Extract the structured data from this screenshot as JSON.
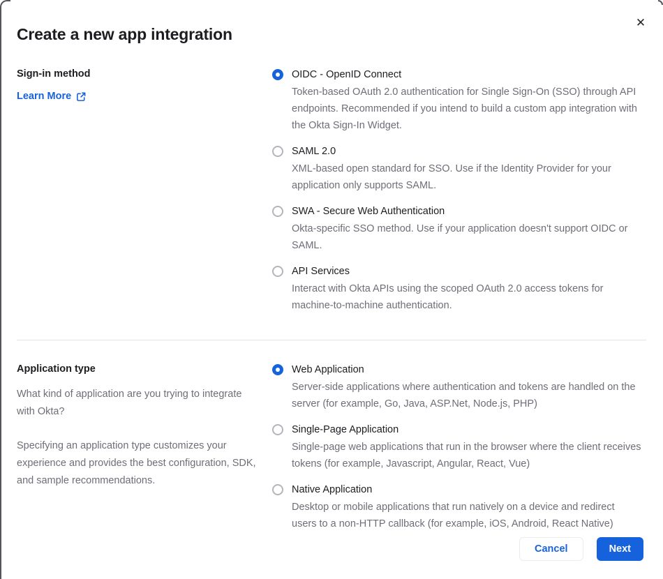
{
  "modal": {
    "title": "Create a new app integration",
    "close_icon": "✕"
  },
  "signin_section": {
    "label": "Sign-in method",
    "learn_more_label": "Learn More",
    "options": [
      {
        "label": "OIDC - OpenID Connect",
        "description": "Token-based OAuth 2.0 authentication for Single Sign-On (SSO) through API endpoints. Recommended if you intend to build a custom app integration with the Okta Sign-In Widget.",
        "selected": true
      },
      {
        "label": "SAML 2.0",
        "description": "XML-based open standard for SSO. Use if the Identity Provider for your application only supports SAML.",
        "selected": false
      },
      {
        "label": "SWA - Secure Web Authentication",
        "description": "Okta-specific SSO method. Use if your application doesn't support OIDC or SAML.",
        "selected": false
      },
      {
        "label": "API Services",
        "description": "Interact with Okta APIs using the scoped OAuth 2.0 access tokens for machine-to-machine authentication.",
        "selected": false
      }
    ]
  },
  "apptype_section": {
    "label": "Application type",
    "intro": "What kind of application are you trying to integrate with Okta?",
    "note": "Specifying an application type customizes your experience and provides the best configuration, SDK, and sample recommendations.",
    "options": [
      {
        "label": "Web Application",
        "description": "Server-side applications where authentication and tokens are handled on the server (for example, Go, Java, ASP.Net, Node.js, PHP)",
        "selected": true
      },
      {
        "label": "Single-Page Application",
        "description": "Single-page web applications that run in the browser where the client receives tokens (for example, Javascript, Angular, React, Vue)",
        "selected": false
      },
      {
        "label": "Native Application",
        "description": "Desktop or mobile applications that run natively on a device and redirect users to a non-HTTP callback (for example, iOS, Android, React Native)",
        "selected": false
      }
    ]
  },
  "footer": {
    "cancel_label": "Cancel",
    "next_label": "Next"
  },
  "colors": {
    "accent_blue": "#1662dd",
    "text_dark": "#1d1d21",
    "text_gray": "#6e6e78",
    "divider": "#e3e3e8",
    "radio_unselected_border": "#b4b4bc"
  }
}
